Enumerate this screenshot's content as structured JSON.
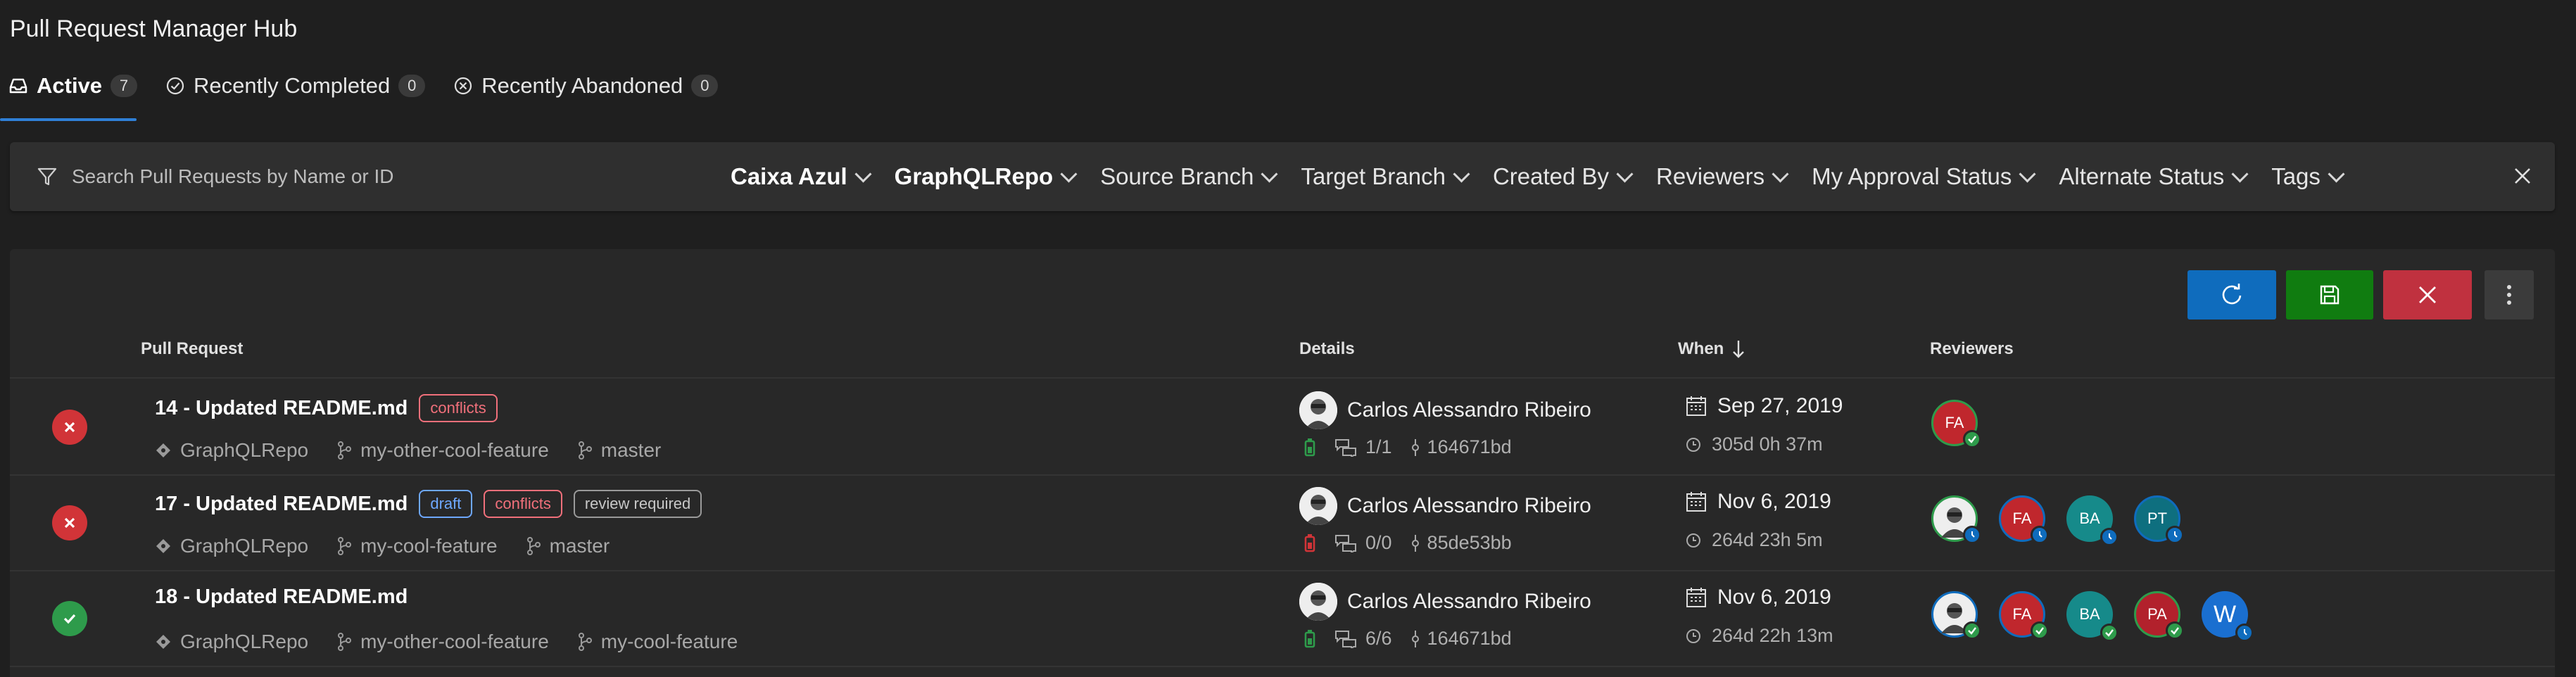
{
  "app": {
    "title": "Pull Request Manager Hub"
  },
  "tabs": [
    {
      "label": "Active",
      "count": "7"
    },
    {
      "label": "Recently Completed",
      "count": "0"
    },
    {
      "label": "Recently Abandoned",
      "count": "0"
    }
  ],
  "search": {
    "placeholder": "Search Pull Requests by Name or ID"
  },
  "filters": [
    "Caixa Azul",
    "GraphQLRepo",
    "Source Branch",
    "Target Branch",
    "Created By",
    "Reviewers",
    "My Approval Status",
    "Alternate Status",
    "Tags"
  ],
  "columns": {
    "pr": "Pull Request",
    "details": "Details",
    "when": "When",
    "reviewers": "Reviewers"
  },
  "colors": {
    "accent": "#0f6cbd",
    "success": "#2e9b4b",
    "danger": "#d13438"
  },
  "rows": [
    {
      "status": "failed",
      "title": "14 - Updated README.md",
      "tags": [
        "conflicts"
      ],
      "repo": "GraphQLRepo",
      "source": "my-other-cool-feature",
      "target": "master",
      "author": "Carlos Alessandro Ribeiro",
      "policy_color": "#2e9b4b",
      "comments": "1/1",
      "commit": "164671bd",
      "date": "Sep 27, 2019",
      "age": "305d 0h 37m",
      "reviewers": [
        {
          "initials": "FA",
          "color": "#c0272d",
          "vote": "approved"
        }
      ]
    },
    {
      "status": "failed",
      "title": "17 - Updated README.md",
      "tags": [
        "draft",
        "conflicts",
        "review required"
      ],
      "repo": "GraphQLRepo",
      "source": "my-cool-feature",
      "target": "master",
      "author": "Carlos Alessandro Ribeiro",
      "policy_color": "#d13438",
      "comments": "0/0",
      "commit": "85de53bb",
      "date": "Nov 6, 2019",
      "age": "264d 23h 5m",
      "reviewers": [
        {
          "initials": "",
          "color": "photo",
          "vote": "waiting"
        },
        {
          "initials": "FA",
          "color": "#c0272d",
          "vote": "waiting"
        },
        {
          "initials": "BA",
          "color": "#168a8a",
          "vote": "waiting"
        },
        {
          "initials": "PT",
          "color": "#0e6f7f",
          "vote": "waiting"
        }
      ]
    },
    {
      "status": "succeeded",
      "title": "18 - Updated README.md",
      "tags": [],
      "repo": "GraphQLRepo",
      "source": "my-other-cool-feature",
      "target": "my-cool-feature",
      "author": "Carlos Alessandro Ribeiro",
      "policy_color": "#2e9b4b",
      "comments": "6/6",
      "commit": "164671bd",
      "date": "Nov 6, 2019",
      "age": "264d 22h 13m",
      "reviewers": [
        {
          "initials": "",
          "color": "photo",
          "vote": "approved"
        },
        {
          "initials": "FA",
          "color": "#c0272d",
          "vote": "approved"
        },
        {
          "initials": "BA",
          "color": "#168a8a",
          "vote": "approved"
        },
        {
          "initials": "PA",
          "color": "#b2212c",
          "vote": "approved"
        },
        {
          "initials": "W",
          "color": "#1a6fd0",
          "vote": "waiting"
        }
      ]
    }
  ]
}
